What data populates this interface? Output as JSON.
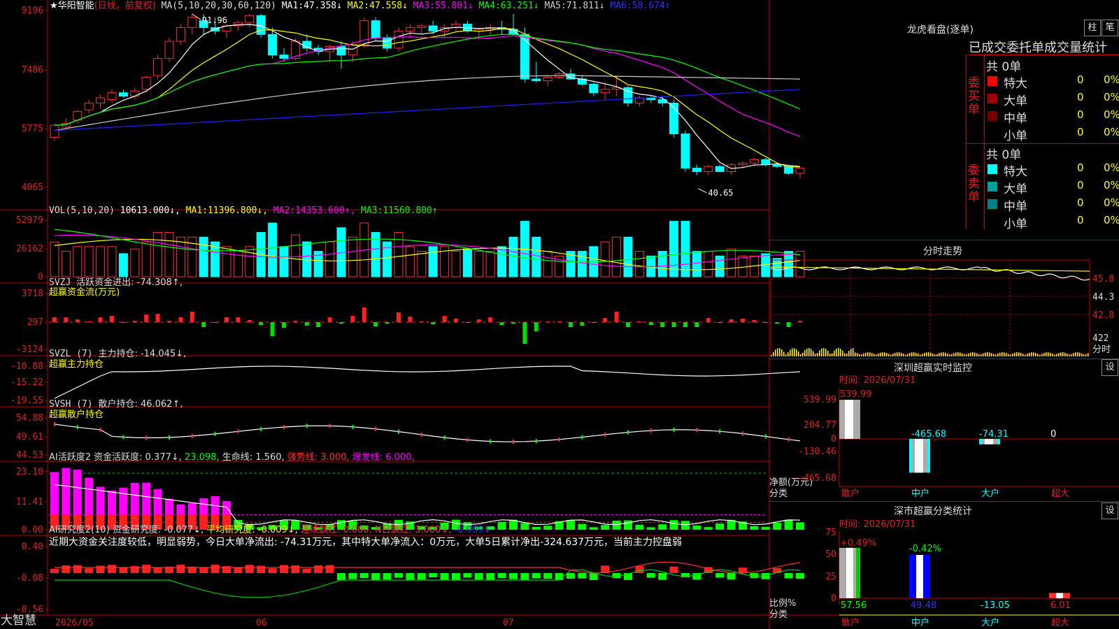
{
  "stock": {
    "name": "★华阳智能",
    "mode": "(日线，前复权)"
  },
  "ma_line": {
    "prefix": "MA(5,10,20,30,60,120)",
    "items": [
      {
        "label": "MA1:",
        "value": "47.358↓",
        "color": "#ffffff"
      },
      {
        "label": "MA2:",
        "value": "47.558↓",
        "color": "#ffff00"
      },
      {
        "label": "MA3:",
        "value": "55.801↓",
        "color": "#ff00ff"
      },
      {
        "label": "MA4:",
        "value": "63.251↓",
        "color": "#00ff00"
      },
      {
        "label": "MA5:",
        "value": "71.811↓",
        "color": "#cccccc"
      },
      {
        "label": "MA6:",
        "value": "58.674↑",
        "color": "#3030ff"
      }
    ]
  },
  "price_axis": [
    "9196",
    "7486",
    "5775",
    "4065"
  ],
  "price_marks": {
    "high": "91.96",
    "low": "40.65"
  },
  "vol": {
    "title": "VOL(5,10,20)",
    "value": "10613.000↓,",
    "ma": [
      {
        "label": "MA1:",
        "value": "11396.800↓,",
        "color": "#ffff00"
      },
      {
        "label": "MA2:",
        "value": "14353.600↑,",
        "color": "#ff00ff"
      },
      {
        "label": "MA3:",
        "value": "11560.800↑",
        "color": "#00ff00"
      }
    ],
    "axis": [
      "52979",
      "26162",
      "0"
    ]
  },
  "svzj": {
    "title": "SVZJ",
    "line": "活跃资金进出: -74.308↑,",
    "sub": "超赢资金流(万元)",
    "axis": [
      "3718",
      "297",
      "-3124"
    ]
  },
  "svzl": {
    "title": "SVZL (7)",
    "line": "主力持仓: -14.045↓,",
    "sub": "超赢主力持仓",
    "axis": [
      "-10.88",
      "-15.22",
      "-19.55"
    ]
  },
  "svsh": {
    "title": "SVSH (7)",
    "line": "散户持仓: 46.062↑,",
    "sub": "超赢散户持仓",
    "axis": [
      "54.88",
      "49.61",
      "44.53"
    ]
  },
  "ai1": {
    "title": "AI活跃度2",
    "items": [
      {
        "text": "资金活跃度: 0.377↓,",
        "color": "#dddddd"
      },
      {
        "text": "23.098,",
        "color": "#00ff00"
      },
      {
        "text": "生命线: 1.560,",
        "color": "#dddddd"
      },
      {
        "text": "强势线: 3.000,",
        "color": "#ff3030"
      },
      {
        "text": "爆发线: 6.000,",
        "color": "#ff00ff"
      }
    ],
    "axis": [
      "23.10",
      "11.41",
      "0.00"
    ]
  },
  "ai2": {
    "title": "AI研究度2(10)",
    "items": [
      {
        "text": "资金研究度: -0.077↓,",
        "color": "#dddddd"
      },
      {
        "text": "平均研究度: -0.009↓,",
        "color": "#ffff00"
      },
      {
        "text": "连续飘红: 0.000,",
        "color": "#ff3030"
      },
      {
        "text": "N日飘红: 3.000↓,",
        "color": "#ff3030"
      },
      {
        "text": "-0.009↓",
        "color": "#3030ff"
      }
    ],
    "comment": "近期大资金关注度较低，明显弱势，今日大单净流出: -74.31万元，其中特大单净流入：0万元，大单5日累计净出-324.637万元，当前主力控盘弱",
    "axis": [
      "0.40",
      "-0.08",
      "-0.56"
    ]
  },
  "date_axis": [
    "2026/05",
    "06",
    "07"
  ],
  "brand": "大智慧",
  "lhb": {
    "title": "龙虎看盘(逐单)",
    "btn1": "柱",
    "btn2": "笔",
    "header": "已成交委托单成交量统计",
    "buy_label": "委买单",
    "sell_label": "委卖单",
    "buy_total": "共 0单",
    "sell_total": "共 0单",
    "buy_rows": [
      {
        "name": "特大",
        "count": "0",
        "pct": "0%",
        "color": "#ff0000"
      },
      {
        "name": "大单",
        "count": "0",
        "pct": "0%",
        "color": "#a00000"
      },
      {
        "name": "中单",
        "count": "0",
        "pct": "0%",
        "color": "#700000"
      },
      {
        "name": "小单",
        "count": "0",
        "pct": "0%",
        "color": ""
      }
    ],
    "sell_rows": [
      {
        "name": "特大",
        "count": "0",
        "pct": "0%",
        "color": "#00ffff"
      },
      {
        "name": "大单",
        "count": "0",
        "pct": "0%",
        "color": "#00a0a0"
      },
      {
        "name": "中单",
        "count": "0",
        "pct": "0%",
        "color": "#008080"
      },
      {
        "name": "小单",
        "count": "0",
        "pct": "0%",
        "color": ""
      }
    ]
  },
  "fenshi": {
    "title": "分时走势",
    "axis": [
      "45.8",
      "44.3",
      "42.8"
    ],
    "vol_label": "422",
    "vol_unit": "分时"
  },
  "monitor": {
    "title": "深圳超赢实时监控",
    "btn": "设",
    "time": "时间: 2026/07/31",
    "axis": [
      "539.99",
      "204.77",
      "0",
      "-130.46",
      "-465.68"
    ],
    "ylabel": "净额(万元)",
    "xlabel": "分类",
    "cats": [
      "散户",
      "中户",
      "大户",
      "超大"
    ],
    "vals": [
      "539.99",
      "-465.68",
      "-74.31",
      "0"
    ]
  },
  "classify": {
    "title": "深市超赢分类统计",
    "btn": "设",
    "time": "时间: 2026/07/31",
    "axis": [
      "75",
      "50",
      "25",
      "0"
    ],
    "ylabel": "比例%",
    "xlabel": "分类",
    "cats": [
      "散户",
      "中户",
      "大户",
      "超大"
    ],
    "top": [
      "+0.49%",
      "-0.42%"
    ],
    "bottom": [
      "57.56",
      "49.48",
      "-13.05",
      "6.01"
    ]
  },
  "chart_data": {
    "type": "candlestick",
    "candles": [
      [
        56.0,
        60.0,
        55.0,
        59.5
      ],
      [
        59.0,
        61.5,
        58.5,
        60.0
      ],
      [
        61.0,
        64.0,
        60.0,
        63.5
      ],
      [
        64.0,
        67.0,
        63.0,
        66.0
      ],
      [
        66.0,
        68.5,
        64.5,
        67.5
      ],
      [
        67.0,
        70.0,
        66.0,
        69.0
      ],
      [
        69.0,
        70.0,
        67.5,
        68.0
      ],
      [
        68.0,
        70.5,
        67.0,
        69.5
      ],
      [
        70.0,
        74.0,
        69.0,
        73.5
      ],
      [
        74.0,
        80.0,
        73.0,
        79.0
      ],
      [
        79.0,
        85.0,
        78.0,
        84.0
      ],
      [
        84.0,
        89.0,
        83.0,
        88.0
      ],
      [
        88.0,
        92.0,
        86.0,
        91.0
      ],
      [
        90.0,
        92.0,
        86.0,
        88.0
      ],
      [
        88.0,
        91.0,
        86.0,
        87.0
      ],
      [
        87.0,
        89.0,
        85.0,
        88.5
      ],
      [
        88.5,
        90.0,
        87.0,
        89.5
      ],
      [
        89.5,
        92.0,
        88.0,
        91.5
      ],
      [
        91.5,
        92.0,
        85.0,
        86.0
      ],
      [
        86.0,
        88.0,
        79.0,
        80.0
      ],
      [
        80.0,
        82.0,
        78.0,
        79.0
      ],
      [
        79.0,
        85.0,
        78.5,
        84.0
      ],
      [
        84.0,
        86.0,
        81.0,
        82.0
      ],
      [
        82.0,
        83.0,
        80.0,
        81.0
      ],
      [
        81.0,
        83.0,
        78.0,
        82.5
      ],
      [
        82.5,
        84.0,
        76.0,
        80.0
      ],
      [
        80.0,
        84.0,
        78.0,
        83.0
      ],
      [
        83.0,
        91.0,
        82.0,
        90.0
      ],
      [
        90.0,
        91.0,
        84.0,
        85.0
      ],
      [
        85.0,
        86.0,
        81.0,
        82.0
      ],
      [
        82.0,
        88.0,
        81.0,
        87.0
      ],
      [
        87.0,
        89.0,
        85.0,
        88.0
      ],
      [
        88.0,
        89.0,
        86.0,
        88.5
      ],
      [
        88.5,
        90.0,
        86.0,
        87.0
      ],
      [
        87.0,
        89.0,
        85.0,
        88.0
      ],
      [
        88.0,
        90.0,
        87.0,
        89.0
      ],
      [
        89.0,
        90.0,
        86.5,
        87.0
      ],
      [
        87.0,
        88.0,
        85.0,
        87.5
      ],
      [
        87.5,
        89.0,
        86.0,
        88.0
      ],
      [
        88.0,
        90.0,
        86.0,
        87.5
      ],
      [
        87.5,
        92.0,
        86.0,
        86.0
      ],
      [
        86.0,
        88.0,
        72.0,
        73.0
      ],
      [
        73.0,
        78.0,
        72.0,
        72.5
      ],
      [
        72.5,
        74.0,
        71.0,
        73.5
      ],
      [
        73.5,
        75.0,
        73.0,
        74.5
      ],
      [
        74.5,
        76.0,
        73.0,
        73.0
      ],
      [
        73.0,
        74.0,
        71.0,
        71.5
      ],
      [
        71.5,
        72.0,
        68.0,
        69.0
      ],
      [
        69.0,
        72.0,
        67.0,
        70.0
      ],
      [
        70.0,
        74.0,
        68.0,
        70.5
      ],
      [
        70.5,
        71.0,
        65.0,
        66.0
      ],
      [
        66.0,
        68.0,
        65.0,
        67.5
      ],
      [
        67.5,
        68.0,
        66.0,
        67.0
      ],
      [
        67.0,
        68.0,
        65.0,
        66.0
      ],
      [
        66.0,
        67.0,
        56.0,
        57.0
      ],
      [
        57.0,
        58.0,
        46.0,
        47.0
      ],
      [
        47.0,
        48.0,
        45.0,
        46.0
      ],
      [
        46.0,
        48.0,
        45.0,
        47.5
      ],
      [
        47.5,
        48.0,
        46.0,
        46.0
      ],
      [
        46.0,
        48.5,
        45.0,
        48.0
      ],
      [
        48.0,
        49.0,
        47.0,
        48.5
      ],
      [
        48.5,
        50.0,
        48.0,
        49.5
      ],
      [
        49.5,
        50.0,
        47.5,
        48.0
      ],
      [
        48.0,
        48.5,
        47.0,
        47.5
      ],
      [
        47.5,
        48.0,
        45.0,
        45.5
      ],
      [
        45.5,
        47.0,
        44.0,
        47.0
      ]
    ],
    "ylim": [
      40.65,
      91.96
    ]
  }
}
